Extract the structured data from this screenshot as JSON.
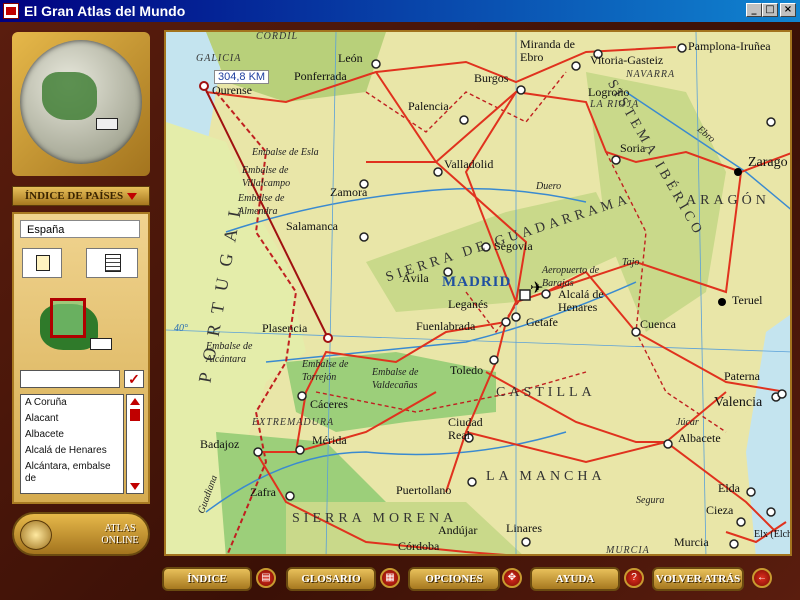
{
  "window": {
    "title": "El Gran Atlas del Mundo",
    "min_glyph": "_",
    "max_glyph": "□",
    "close_glyph": "×"
  },
  "left_panel": {
    "countries_button": "ÍNDICE DE PAÍSES",
    "country_tab": "España",
    "search_value": "",
    "ok_glyph": "✓",
    "places": [
      "A Coruña",
      "Alacant",
      "Albacete",
      "Alcalá de Henares",
      "Alcántara, embalse de"
    ],
    "atlas_online_label": "ATLAS ONLINE"
  },
  "map": {
    "distance": "304,8 KM",
    "colors": {
      "land": "#e9e6a8",
      "highland": "#c9d98a",
      "lowland": "#9ccf7a",
      "sea": "#c4e4ef",
      "road": "#e0321e",
      "border": "#c02020",
      "river": "#3a8ad0"
    },
    "labels": {
      "galicia": "GALICIA",
      "ourense": "Ourense",
      "leon": "León",
      "ponferrada": "Ponferrada",
      "burgos": "Burgos",
      "miranda": "Miranda de Ebro",
      "vitoria": "Vitoria-Gasteiz",
      "pamplona": "Pamplona-Iruñea",
      "navarra": "NAVARRA",
      "logrono": "Logroño",
      "rioja": "LA RIOJA",
      "palencia": "Palencia",
      "valladolid": "Valladolid",
      "soria": "Soria",
      "zaragoza": "Zarago",
      "aragon": "ARAGÓN",
      "embalse_esla": "Embalse de Esla",
      "embalse_villalcampo": "Embalse de Villalcampo",
      "embalse_almendra": "Embalse de Almendra",
      "zamora": "Zamora",
      "salamanca": "Salamanca",
      "segovia": "Segovia",
      "avila": "Ávila",
      "madrid": "MADRID",
      "aeropuerto": "Aeropuerto de Barajas",
      "alcala": "Alcalá de Henares",
      "leganes": "Leganés",
      "getafe": "Getafe",
      "fuenlabrada": "Fuenlabrada",
      "teruel": "Teruel",
      "cuenca": "Cuenca",
      "plasencia": "Plasencia",
      "embalse_alcantara": "Embalse de Alcántara",
      "embalse_torrejon": "Embalse de Torrejón",
      "embalse_valdecanas": "Embalse de Valdecañas",
      "toledo": "Toledo",
      "caceres": "Cáceres",
      "extremadura": "EXTREMADURA",
      "merida": "Mérida",
      "badajoz": "Badajoz",
      "ciudad_real": "Ciudad Real",
      "castilla": "CASTILLA",
      "lamancha": "LA MANCHA",
      "albacete": "Albacete",
      "valencia": "Valencia",
      "paterna": "Paterna",
      "jucar": "Júcar",
      "elda": "Elda",
      "cieza": "Cieza",
      "murcia": "Murcia",
      "murcia_region": "MURCIA",
      "elx": "Elx (Elche)",
      "segura": "Segura",
      "zafra": "Zafra",
      "puertollano": "Puertollano",
      "andujar": "Andújar",
      "linares": "Linares",
      "cordoba": "Córdoba",
      "sierra_morena": "SIERRA MORENA",
      "sierra_guadarrama": "SIERRA DE GUADARRAMA",
      "sistema_iberico": "SISTEMA IBÉRICO",
      "portugal": "PORTUGAL",
      "guadiana": "Guadiana",
      "tajo": "Tajo",
      "duero": "Duero",
      "ebro": "Ebro",
      "lat40": "40°",
      "cordillera": "CORDIL"
    }
  },
  "bottom_bar": {
    "indice": "ÍNDICE",
    "glosario": "GLOSARIO",
    "opciones": "OPCIONES",
    "ayuda": "AYUDA",
    "volver": "VOLVER ATRÁS"
  }
}
